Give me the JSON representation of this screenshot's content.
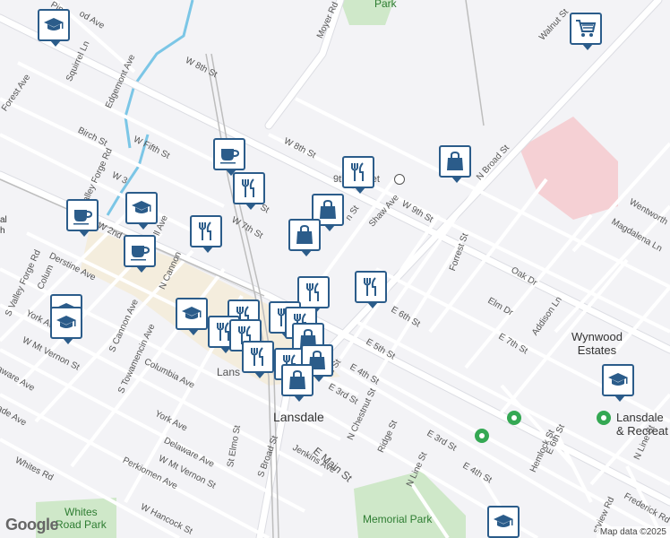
{
  "map": {
    "attribution": "Map data ©2025",
    "logo": "Google",
    "colors": {
      "background": "#f3f3f6",
      "road": "#ffffff",
      "road_casing": "#dcdde3",
      "park": "#cfe8c9",
      "hospital": "#f5d0d4",
      "rail": "#bdbdbd",
      "water": "#7bc6e6",
      "pin_border": "#2b5c8a",
      "downtown": "#f4e8c8"
    },
    "streets": [
      {
        "id": "w-8th-st-upper",
        "name": "W 8th St"
      },
      {
        "id": "w-8th-st-lower",
        "name": "W 8th St"
      },
      {
        "id": "moyer-rd",
        "name": "Moyer Rd"
      },
      {
        "id": "squirrel-ln",
        "name": "Squirrel Ln"
      },
      {
        "id": "edgemont-ave",
        "name": "Edgemont Ave"
      },
      {
        "id": "forest-ave",
        "name": "Forest Ave"
      },
      {
        "id": "birch-st",
        "name": "Birch St"
      },
      {
        "id": "w-fifth-st",
        "name": "W Fifth St"
      },
      {
        "id": "valley-forge-rd",
        "name": "Valley Forge Rd"
      },
      {
        "id": "w-3rd",
        "name": "W 3"
      },
      {
        "id": "w-2nd-st",
        "name": "W 2nd St"
      },
      {
        "id": "hill-ave",
        "name": "ll Ave"
      },
      {
        "id": "s-valley-forge-rd",
        "name": "S Valley Forge Rd"
      },
      {
        "id": "derstine-ave",
        "name": "Derstine Ave"
      },
      {
        "id": "n-cannon-ave",
        "name": "N Cannon"
      },
      {
        "id": "s-cannon-ave",
        "name": "S Cannon Ave"
      },
      {
        "id": "s-towamencin-ave",
        "name": "S Towamencin Ave"
      },
      {
        "id": "columbia-ave",
        "name": "Columbia Ave"
      },
      {
        "id": "york-ave",
        "name": "York Ave"
      },
      {
        "id": "york-ave-2",
        "name": "York Ave"
      },
      {
        "id": "w-mt-vernon-st",
        "name": "W Mt Vernon St"
      },
      {
        "id": "w-mt-vernon-st-2",
        "name": "W Mt Vernon St"
      },
      {
        "id": "delaware-ave",
        "name": "Delaware Ave"
      },
      {
        "id": "perkiomen-ave",
        "name": "Perkiomen Ave"
      },
      {
        "id": "whites-rd",
        "name": "Whites Rd"
      },
      {
        "id": "w-hancock-st",
        "name": "W Hancock St"
      },
      {
        "id": "s-elmo-st",
        "name": "St Elmo St"
      },
      {
        "id": "s-broad-st",
        "name": "S Broad St"
      },
      {
        "id": "jenkins-ave",
        "name": "Jenkins Ave"
      },
      {
        "id": "e-main-st",
        "name": "E Main St"
      },
      {
        "id": "n-chestnut-st",
        "name": "N Chestnut St"
      },
      {
        "id": "ridge-st",
        "name": "Ridge St"
      },
      {
        "id": "n-line-st",
        "name": "N Line St"
      },
      {
        "id": "n-line-st-2",
        "name": "N Line St"
      },
      {
        "id": "e-3rd-st",
        "name": "E 3rd St"
      },
      {
        "id": "e-3rd-st-2",
        "name": "E 3rd St"
      },
      {
        "id": "e-4th-st",
        "name": "E 4th St"
      },
      {
        "id": "e-4th-st-2",
        "name": "E 4th St"
      },
      {
        "id": "e-5th-st",
        "name": "E 5th St"
      },
      {
        "id": "e-6th-st",
        "name": "E 6th St"
      },
      {
        "id": "e-6th-st-2",
        "name": "E 6th St"
      },
      {
        "id": "e-7th-st",
        "name": "E 7th St"
      },
      {
        "id": "n-broad-st",
        "name": "N Broad St"
      },
      {
        "id": "walnut-st",
        "name": "Walnut St"
      },
      {
        "id": "shaw-ave",
        "name": "Shaw Ave"
      },
      {
        "id": "w-9th-st",
        "name": "W 9th St"
      },
      {
        "id": "forrest-st",
        "name": "Forrest St"
      },
      {
        "id": "oak-dr",
        "name": "Oak Dr"
      },
      {
        "id": "elm-dr",
        "name": "Elm Dr"
      },
      {
        "id": "addison-ln",
        "name": "Addison Ln"
      },
      {
        "id": "magdalena-ln",
        "name": "Magdalena Ln"
      },
      {
        "id": "wentworth",
        "name": "Wentworth"
      },
      {
        "id": "hemlock-st",
        "name": "Hemlock St"
      },
      {
        "id": "frederick-rd",
        "name": "Frederick Rd"
      },
      {
        "id": "fairview-rd",
        "name": "stview Rd"
      },
      {
        "id": "w-7th-st",
        "name": "W 7th St"
      },
      {
        "id": "w-5th-fragment",
        "name": "W 5th St"
      },
      {
        "id": "n-5th-fragment",
        "name": "St"
      },
      {
        "id": "columbia-fragment",
        "name": "Colum"
      },
      {
        "id": "ware-ave",
        "name": "aware Ave"
      },
      {
        "id": "ade-ave",
        "name": "ade Ave"
      },
      {
        "id": "pine-ave",
        "name": "Pine"
      },
      {
        "id": "wood-ave",
        "name": "od Ave"
      },
      {
        "id": "n-st-fragment",
        "name": "n St"
      },
      {
        "id": "rd-st-fragment",
        "name": "rd St"
      },
      {
        "id": "lanes-fragment",
        "name": "Lans"
      },
      {
        "id": "market-fragment",
        "name": "9th Market"
      }
    ],
    "places": [
      {
        "id": "lansdale",
        "name": "Lansdale"
      },
      {
        "id": "wynwood-estates",
        "name": "Wynwood\nEstates"
      },
      {
        "id": "lansdale-recreation",
        "name": "Lansdale\n& Recreat"
      },
      {
        "id": "al-fragment",
        "name": "al\nh"
      }
    ],
    "parks": [
      {
        "id": "memorial-park",
        "name": "Memorial Park"
      },
      {
        "id": "whites-road-park",
        "name": "Whites\nRoad Park"
      },
      {
        "id": "park-top",
        "name": "Park"
      }
    ],
    "markers": [
      {
        "id": "m1",
        "category": "school",
        "icon": "school-icon"
      },
      {
        "id": "m2",
        "category": "grocery",
        "icon": "shopping-cart-icon"
      },
      {
        "id": "m3",
        "category": "cafe",
        "icon": "coffee-cup-icon"
      },
      {
        "id": "m4",
        "category": "restaurant",
        "icon": "fork-knife-icon"
      },
      {
        "id": "m5",
        "category": "restaurant",
        "icon": "fork-knife-icon"
      },
      {
        "id": "m6",
        "category": "shopping",
        "icon": "shopping-bag-icon"
      },
      {
        "id": "m7",
        "category": "shopping",
        "icon": "shopping-bag-icon"
      },
      {
        "id": "m8",
        "category": "shopping",
        "icon": "shopping-bag-icon"
      },
      {
        "id": "m9",
        "category": "school",
        "icon": "school-icon"
      },
      {
        "id": "m10",
        "category": "cafe",
        "icon": "coffee-cup-icon"
      },
      {
        "id": "m11",
        "category": "cafe",
        "icon": "coffee-cup-icon"
      },
      {
        "id": "m12",
        "category": "restaurant",
        "icon": "fork-knife-icon"
      },
      {
        "id": "m13",
        "category": "school",
        "icon": "school-icon"
      },
      {
        "id": "m14",
        "category": "school",
        "icon": "school-icon"
      },
      {
        "id": "m15",
        "category": "restaurant",
        "icon": "fork-knife-icon"
      },
      {
        "id": "m16",
        "category": "restaurant",
        "icon": "fork-knife-icon"
      },
      {
        "id": "m17",
        "category": "school",
        "icon": "school-icon"
      },
      {
        "id": "m18",
        "category": "restaurant",
        "icon": "fork-knife-icon"
      },
      {
        "id": "m19",
        "category": "restaurant",
        "icon": "fork-knife-icon"
      },
      {
        "id": "m20",
        "category": "restaurant",
        "icon": "fork-knife-icon"
      },
      {
        "id": "m21",
        "category": "restaurant",
        "icon": "fork-knife-icon"
      },
      {
        "id": "m22",
        "category": "restaurant",
        "icon": "fork-knife-icon"
      },
      {
        "id": "m23",
        "category": "shopping",
        "icon": "shopping-bag-icon"
      },
      {
        "id": "m24",
        "category": "restaurant",
        "icon": "fork-knife-icon"
      },
      {
        "id": "m25",
        "category": "restaurant",
        "icon": "fork-knife-icon"
      },
      {
        "id": "m26",
        "category": "shopping",
        "icon": "shopping-bag-icon"
      },
      {
        "id": "m27",
        "category": "shopping",
        "icon": "shopping-bag-icon"
      },
      {
        "id": "m28",
        "category": "school",
        "icon": "school-icon"
      },
      {
        "id": "m29",
        "category": "school",
        "icon": "school-icon"
      }
    ]
  }
}
